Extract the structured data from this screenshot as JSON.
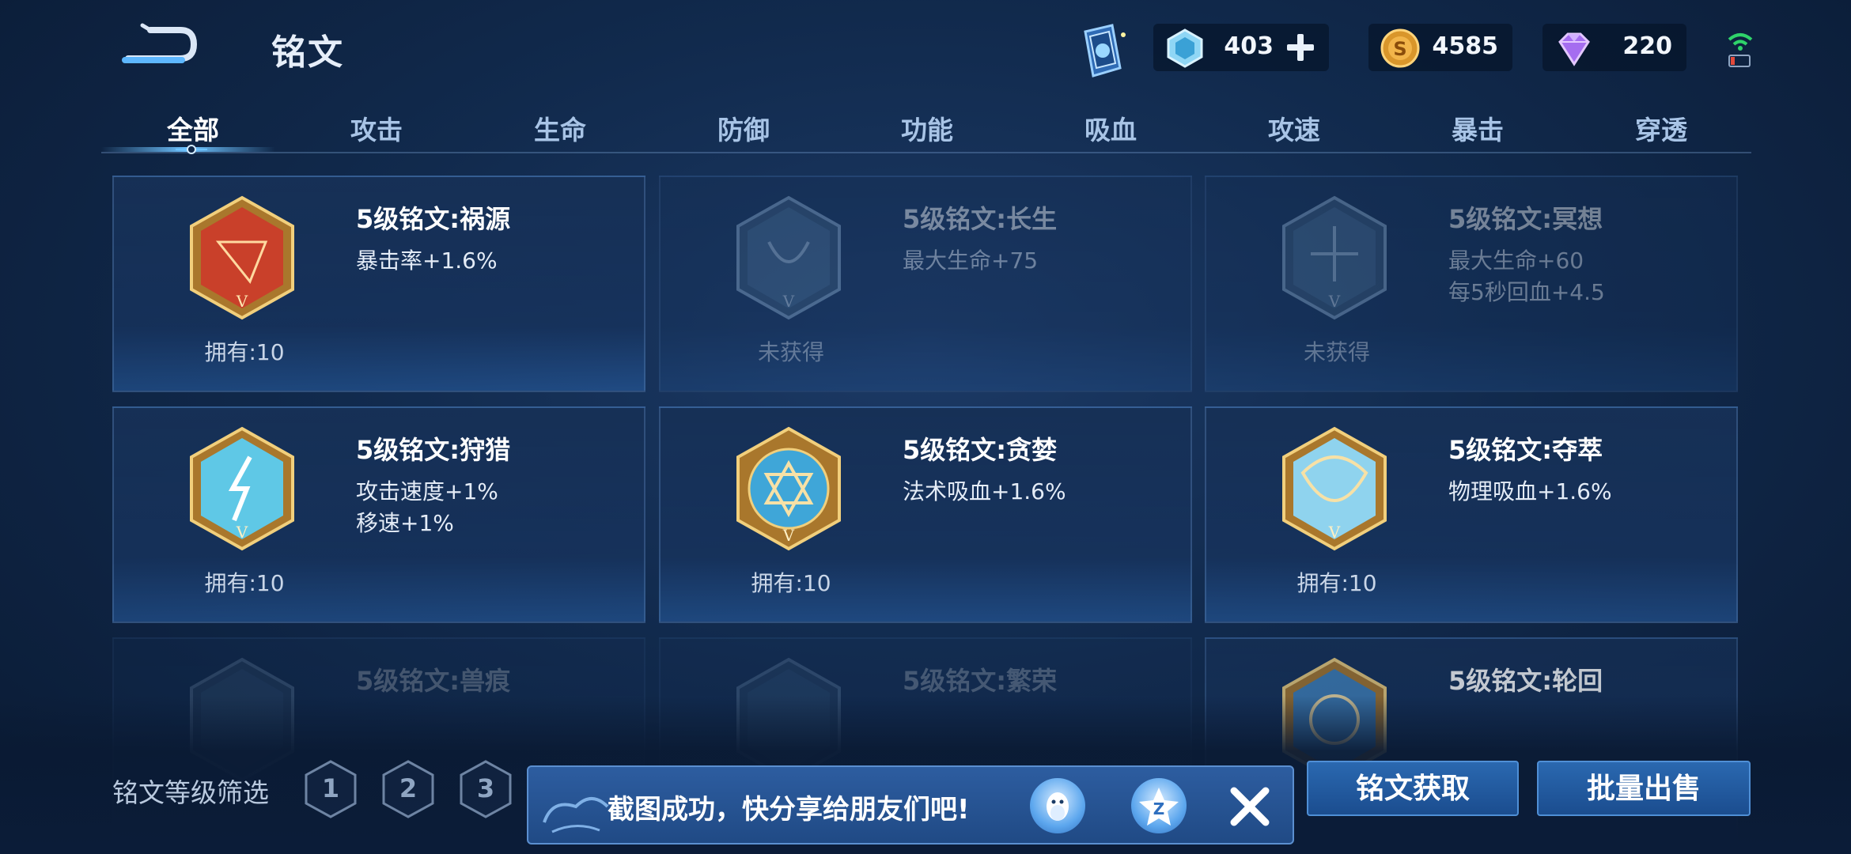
{
  "header": {
    "title": "铭文",
    "currencies": {
      "ticket": "403",
      "gold": "4585",
      "gem": "220"
    }
  },
  "tabs": [
    "全部",
    "攻击",
    "生命",
    "防御",
    "功能",
    "吸血",
    "攻速",
    "暴击",
    "穿透"
  ],
  "active_tab": "全部",
  "runes": [
    {
      "name": "5级铭文:祸源",
      "stats": [
        "暴击率+1.6%"
      ],
      "count": "拥有:10",
      "color": "#c9402a"
    },
    {
      "name": "5级铭文:长生",
      "stats": [
        "最大生命+75"
      ],
      "count": "未获得",
      "color": "#4a6f95"
    },
    {
      "name": "5级铭文:冥想",
      "stats": [
        "最大生命+60",
        "每5秒回血+4.5"
      ],
      "count": "未获得",
      "color": "#4a6f95"
    },
    {
      "name": "5级铭文:狩猎",
      "stats": [
        "攻击速度+1%",
        "移速+1%"
      ],
      "count": "拥有:10",
      "color": "#5fc8e6"
    },
    {
      "name": "5级铭文:贪婪",
      "stats": [
        "法术吸血+1.6%"
      ],
      "count": "拥有:10",
      "color": "#3fa6d8"
    },
    {
      "name": "5级铭文:夺萃",
      "stats": [
        "物理吸血+1.6%"
      ],
      "count": "拥有:10",
      "color": "#8fd3ee"
    },
    {
      "name": "5级铭文:兽痕",
      "stats": [],
      "count": "",
      "color": "#4a6f95"
    },
    {
      "name": "5级铭文:繁荣",
      "stats": [],
      "count": "",
      "color": "#4a6f95"
    },
    {
      "name": "5级铭文:轮回",
      "stats": [],
      "count": "",
      "color": "#3f7fb8"
    }
  ],
  "filter": {
    "label": "铭文等级筛选",
    "levels": [
      "1",
      "2",
      "3"
    ]
  },
  "actions": {
    "obtain": "铭文获取",
    "bulk_sell": "批量出售"
  },
  "toast": {
    "message": "截图成功，快分享给朋友们吧!"
  },
  "colors": {
    "accent": "#6ec3ff",
    "background": "#112a4d",
    "button": "#2a68b0"
  }
}
